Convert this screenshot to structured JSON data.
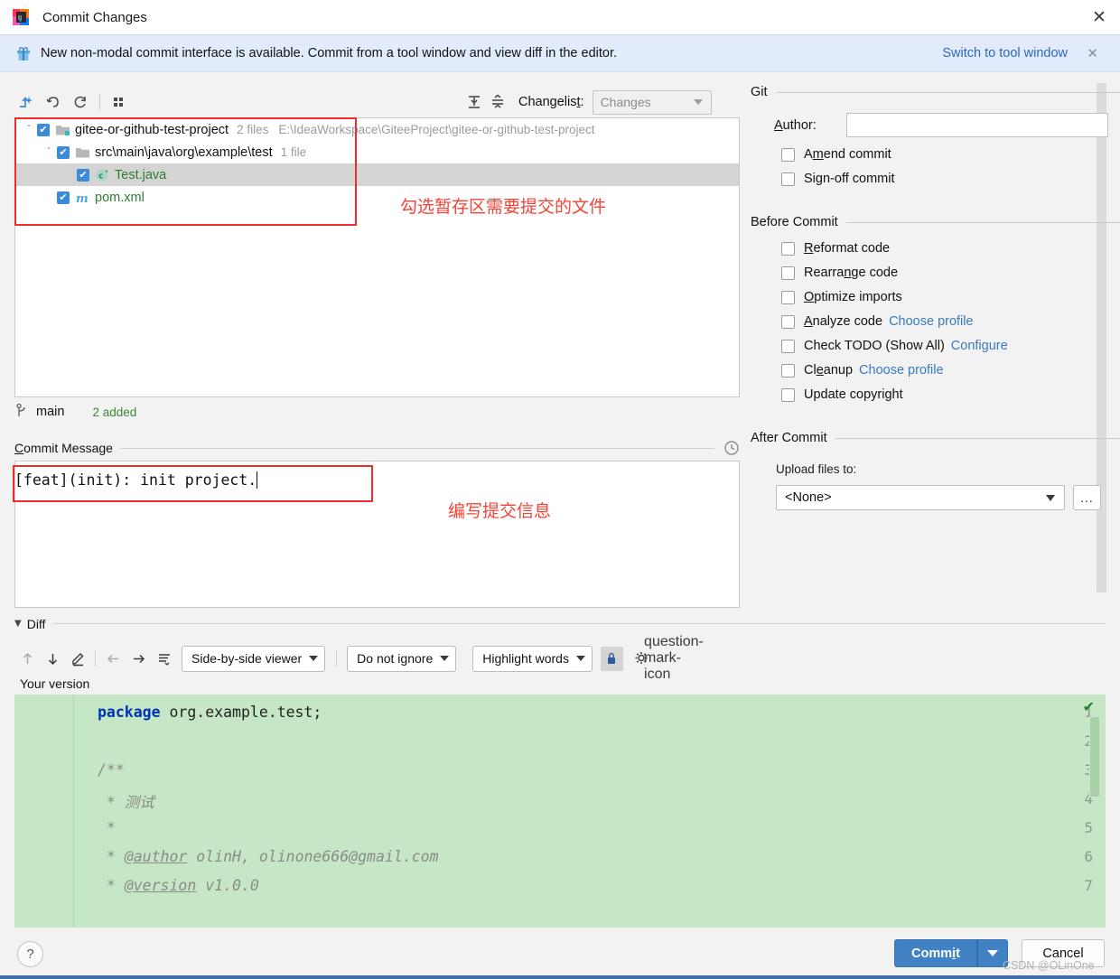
{
  "window": {
    "title": "Commit Changes",
    "app_icon": "intellij-idea-icon",
    "close_label": "✕"
  },
  "notification": {
    "icon": "gift-icon",
    "message": "New non-modal commit interface is available. Commit from a tool window and view diff in the editor.",
    "link": "Switch to tool window",
    "dismiss": "✕"
  },
  "toolbar": {
    "buttons": [
      {
        "name": "move-to-another-changelist-icon",
        "glyph": "↲"
      },
      {
        "name": "rollback-icon",
        "glyph": "↺"
      },
      {
        "name": "refresh-icon",
        "glyph": "⟳"
      },
      {
        "name": "group-by-icon",
        "glyph": "∷"
      }
    ],
    "expand_all": "expand-all-icon",
    "collapse_all": "collapse-all-icon",
    "changelist_label": "Changelist:",
    "changelist_value": "Changes"
  },
  "tree": {
    "rows": [
      {
        "indent": 0,
        "twisty": "⌄",
        "checked": true,
        "icon": "module-folder-icon",
        "name": "gitee-or-github-test-project",
        "count": "2 files",
        "path": "E:\\IdeaWorkspace\\GiteeProject\\gitee-or-github-test-project",
        "selected": false,
        "name_class": ""
      },
      {
        "indent": 1,
        "twisty": "⌄",
        "checked": true,
        "icon": "folder-icon",
        "name": "src\\main\\java\\org\\example\\test",
        "count": "1 file",
        "path": "",
        "selected": false,
        "name_class": ""
      },
      {
        "indent": 2,
        "twisty": "",
        "checked": true,
        "icon": "java-class-icon",
        "name": "Test.java",
        "count": "",
        "path": "",
        "selected": true,
        "name_class": "java"
      },
      {
        "indent": 1,
        "twisty": "",
        "checked": true,
        "icon": "maven-pom-icon",
        "name": "pom.xml",
        "count": "",
        "path": "",
        "selected": false,
        "name_class": "java"
      }
    ]
  },
  "annotations": {
    "files_note": "勾选暂存区需要提交的文件",
    "message_note": "编写提交信息"
  },
  "branch": {
    "icon": "git-branch-icon",
    "name": "main",
    "added": "2 added"
  },
  "commit_message": {
    "title": "Commit Message",
    "title_mnemonic": "C",
    "title_rest": "ommit Message",
    "history_icon": "clock-history-icon",
    "value": "[feat](init): init project."
  },
  "git_section": {
    "title": "Git",
    "author_label_mnemonic": "A",
    "author_label_rest": "uthor:",
    "author_value": "",
    "checkboxes": [
      {
        "label_pre": "A",
        "label_mn": "m",
        "label_post": "end commit",
        "checked": false,
        "link": ""
      },
      {
        "label_pre": "Si",
        "label_mn": "g",
        "label_post": "n-off commit",
        "checked": false,
        "link": ""
      }
    ]
  },
  "before_commit": {
    "title": "Before Commit",
    "checkboxes": [
      {
        "label_pre": "",
        "label_mn": "R",
        "label_post": "eformat code",
        "checked": false,
        "link": ""
      },
      {
        "label_pre": "Rearra",
        "label_mn": "n",
        "label_post": "ge code",
        "checked": false,
        "link": ""
      },
      {
        "label_pre": "",
        "label_mn": "O",
        "label_post": "ptimize imports",
        "checked": false,
        "link": ""
      },
      {
        "label_pre": "",
        "label_mn": "A",
        "label_post": "nalyze code",
        "checked": false,
        "link": "Choose profile"
      },
      {
        "label_pre": "Check TODO (Show All)",
        "label_mn": "",
        "label_post": "",
        "checked": false,
        "link": "Configure"
      },
      {
        "label_pre": "Cl",
        "label_mn": "e",
        "label_post": "anup",
        "checked": false,
        "link": "Choose profile"
      },
      {
        "label_pre": "Update copyright",
        "label_mn": "",
        "label_post": "",
        "checked": false,
        "link": ""
      }
    ]
  },
  "after_commit": {
    "title": "After Commit",
    "upload_label": "Upload files to:",
    "upload_value": "<None>",
    "browse_label": "..."
  },
  "diff": {
    "section_title": "Diff",
    "caret": "▼",
    "icon_buttons": [
      {
        "name": "previous-difference-icon",
        "glyph": "↑"
      },
      {
        "name": "next-difference-icon",
        "glyph": "↓"
      },
      {
        "name": "edit-source-icon",
        "glyph": "✎"
      },
      {
        "name": "accept-left-icon",
        "glyph": "←"
      },
      {
        "name": "accept-right-icon",
        "glyph": "→"
      },
      {
        "name": "collapse-unchanged-icon",
        "glyph": "≡"
      }
    ],
    "viewer_mode": "Side-by-side viewer",
    "whitespace_mode": "Do not ignore",
    "highlight_mode": "Highlight words",
    "lock_icon": "lock-icon",
    "settings_icon": "gear-icon",
    "help_icon": "question-mark-icon",
    "pane_label": "Your version",
    "status_check": "✔"
  },
  "code": {
    "lines": [
      {
        "no": "1",
        "segments": [
          {
            "t": "package ",
            "c": "kw"
          },
          {
            "t": "org.example.test;",
            "c": ""
          }
        ]
      },
      {
        "no": "2",
        "segments": [
          {
            "t": "",
            "c": ""
          }
        ]
      },
      {
        "no": "3",
        "segments": [
          {
            "t": "/**",
            "c": "cmt"
          }
        ]
      },
      {
        "no": "4",
        "segments": [
          {
            "t": " * 测试",
            "c": "cmt"
          }
        ]
      },
      {
        "no": "5",
        "segments": [
          {
            "t": " *",
            "c": "cmt"
          }
        ]
      },
      {
        "no": "6",
        "segments": [
          {
            "t": " * ",
            "c": "cmt"
          },
          {
            "t": "@author",
            "c": "tag"
          },
          {
            "t": " olinH, olinone666@gmail.com",
            "c": "cmt"
          }
        ]
      },
      {
        "no": "7",
        "segments": [
          {
            "t": " * ",
            "c": "cmt"
          },
          {
            "t": "@version",
            "c": "tag"
          },
          {
            "t": " v1.0.0",
            "c": "cmt"
          }
        ]
      }
    ]
  },
  "footer": {
    "help": "?",
    "commit": "Commit",
    "commit_mnemonic": "i",
    "cancel": "Cancel",
    "watermark": "CSDN @OLinOne"
  },
  "colors": {
    "accent": "#4182c4",
    "link": "#2a68c4",
    "annotation": "#f44336",
    "diff_added": "#c6e7c6",
    "checkbox_checked": "#3a8cdb",
    "notification_bg": "#e2ebfb"
  }
}
